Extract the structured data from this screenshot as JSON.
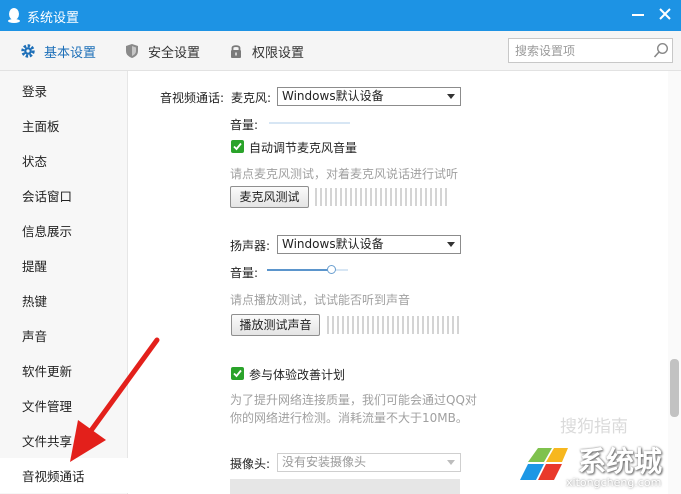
{
  "window": {
    "title": "系统设置",
    "logo_icon": "qq-penguin-icon",
    "accent_color": "#1d93e4"
  },
  "tabs": [
    {
      "label": "基本设置",
      "icon": "gear-icon",
      "active": true
    },
    {
      "label": "安全设置",
      "icon": "shield-icon",
      "active": false
    },
    {
      "label": "权限设置",
      "icon": "lock-icon",
      "active": false
    }
  ],
  "search": {
    "placeholder": "搜索设置项",
    "icon": "search-icon"
  },
  "sidebar": {
    "items": [
      {
        "label": "登录"
      },
      {
        "label": "主面板"
      },
      {
        "label": "状态"
      },
      {
        "label": "会话窗口"
      },
      {
        "label": "信息展示"
      },
      {
        "label": "提醒"
      },
      {
        "label": "热键"
      },
      {
        "label": "声音"
      },
      {
        "label": "软件更新"
      },
      {
        "label": "文件管理"
      },
      {
        "label": "文件共享"
      },
      {
        "label": "音视频通话",
        "active": true
      }
    ]
  },
  "av": {
    "section_label": "音视频通话:",
    "mic": {
      "label": "麦克风:",
      "device": "Windows默认设备",
      "volume_label": "音量:",
      "auto_adjust_label": "自动调节麦克风音量",
      "auto_adjust_checked": true,
      "test_hint": "请点麦克风测试，对着麦克风说话进行试听",
      "test_button": "麦克风测试"
    },
    "speaker": {
      "label": "扬声器:",
      "device": "Windows默认设备",
      "volume_label": "音量:",
      "volume_level": 0.8,
      "test_hint": "请点播放测试，试试能否听到声音",
      "test_button": "播放测试声音"
    },
    "experience": {
      "label": "参与体验改善计划",
      "checked": true,
      "desc_line1": "为了提升网络连接质量，我们可能会通过QQ对",
      "desc_line2": "你的网络进行检测。消耗流量不大于10MB。"
    },
    "camera": {
      "label": "摄像头:",
      "device": "没有安装摄像头"
    }
  },
  "watermark": {
    "brand_line": "搜狗指南",
    "site_name": "系统城",
    "site_url": "xitongcheng.com"
  }
}
